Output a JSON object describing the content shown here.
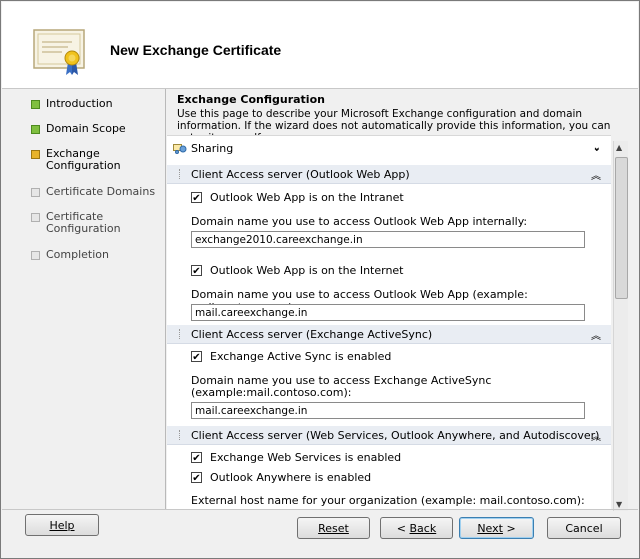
{
  "window": {
    "title": "New Exchange Certificate"
  },
  "sidebar": {
    "steps": [
      {
        "label": "Introduction",
        "status": "complete",
        "color": "#7fbf3f"
      },
      {
        "label": "Domain Scope",
        "status": "complete",
        "color": "#7fbf3f"
      },
      {
        "label": "Exchange Configuration",
        "status": "current",
        "color": "#e8b32a"
      },
      {
        "label": "Certificate Domains",
        "status": "pending",
        "color": "#e6e6e6"
      },
      {
        "label": "Certificate Configuration",
        "status": "pending",
        "color": "#e6e6e6"
      },
      {
        "label": "Completion",
        "status": "pending",
        "color": "#e6e6e6"
      }
    ]
  },
  "main": {
    "title": "Exchange Configuration",
    "description": "Use this page to describe your Microsoft Exchange configuration and domain information. If the wizard does not automatically provide this information, you can enter it yourself.",
    "sharing": {
      "label": "Sharing",
      "expand_icon": "double-chevron-down-icon"
    },
    "owa": {
      "header": "Client Access server (Outlook Web App)",
      "intranet_checkbox": {
        "label": "Outlook Web App is on the Intranet",
        "checked": true
      },
      "internal_label": "Domain name you use to access Outlook Web App internally:",
      "internal_value": "exchange2010.careexchange.in",
      "internet_checkbox": {
        "label": "Outlook Web App is on the Internet",
        "checked": true
      },
      "external_label": "Domain name you use to access Outlook Web App (example: mail.contoso.com):",
      "external_value": "mail.careexchange.in"
    },
    "activesync": {
      "header": "Client Access server (Exchange ActiveSync)",
      "enabled_checkbox": {
        "label": "Exchange Active Sync is enabled",
        "checked": true
      },
      "domain_label_1": "Domain name you use to access Exchange ActiveSync",
      "domain_label_2": "(example:mail.contoso.com):",
      "domain_value": "mail.careexchange.in"
    },
    "webservices": {
      "header": "Client Access server (Web Services, Outlook Anywhere, and Autodiscover)",
      "ews_checkbox": {
        "label": "Exchange Web Services is enabled",
        "checked": true
      },
      "oa_checkbox": {
        "label": "Outlook Anywhere is enabled",
        "checked": true
      },
      "external_host_label": "External host name for your organization (example: mail.contoso.com):"
    },
    "check_glyph": "✔",
    "collapse_glyph": "⌃"
  },
  "footer": {
    "help": "Help",
    "reset": "Reset",
    "back_prefix": "< ",
    "back": "Back",
    "next": "Next",
    "next_suffix": " >",
    "cancel": "Cancel"
  }
}
